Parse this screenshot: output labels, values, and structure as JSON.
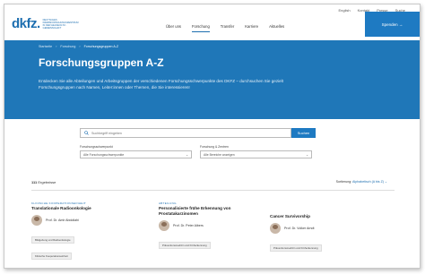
{
  "logo": {
    "mark": "dkfz.",
    "text": "DEUTSCHES KREBSFORSCHUNGSZENTRUM IN DER HELMHOLTZ-GEMEINSCHAFT"
  },
  "utility_nav": [
    "English",
    "Kontakt",
    "Presse",
    "Suche"
  ],
  "main_nav": [
    {
      "label": "Über uns",
      "active": false
    },
    {
      "label": "Forschung",
      "active": true
    },
    {
      "label": "Transfer",
      "active": false
    },
    {
      "label": "Karriere",
      "active": false
    },
    {
      "label": "Aktuelles",
      "active": false
    }
  ],
  "donate_label": "Spenden →",
  "breadcrumb": [
    "Startseite",
    "Forschung",
    "Forschungsgruppen A-Z"
  ],
  "page_title": "Forschungsgruppen A-Z",
  "intro": "Entdecken Sie alle Abteilungen und Arbeitsgruppen der verschiedenen Forschungsschwerpunkte des DKFZ – durchsuchen Sie gezielt Forschungsgruppen nach Namen, Leiter:innen oder Themen, die Sie interessieren!",
  "search": {
    "placeholder": "Suchbegriff eingeben",
    "button": "Suchen"
  },
  "filters": [
    {
      "label": "Forschungsschwerpunkt",
      "value": "Alle Forschungsschwerpunkte"
    },
    {
      "label": "Forschung & Zentren",
      "value": "Alle Bereiche anzeigen"
    }
  ],
  "results": {
    "count": "111",
    "label": "Ergebnisse"
  },
  "sort": {
    "label": "Sortierung:",
    "value": "Alphabetisch (A bis Z)"
  },
  "cards": [
    {
      "category": "KLINISCHE KOOPERATIONSEINHEIT",
      "title": "Translationale Radioonkologie",
      "person": "Prof. Dr. Amir Abdollahi",
      "tags": [
        "Bildgebung und Radioonkologie",
        "Klinische Kooperationseinheit"
      ]
    },
    {
      "category": "ABTEILUNG",
      "title": "Personalisierte frühe Erkennung von Prostatakarzinomen",
      "person": "Prof. Dr. Peter Albers",
      "tags": [
        "Präventionsmedizin und Früherkennung"
      ]
    },
    {
      "category": "",
      "title": "Cancer Survivorship",
      "person": "Prof. Dr. Volker Arndt",
      "tags": [
        "Präventionsmedizin und Früherkennung"
      ]
    }
  ]
}
